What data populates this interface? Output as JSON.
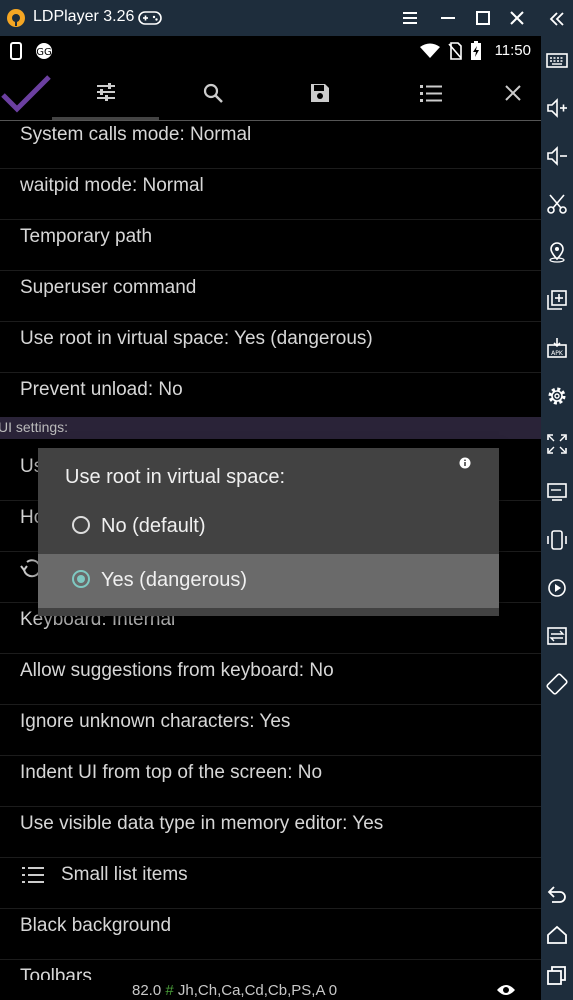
{
  "app": {
    "title": "LDPlayer 3.26"
  },
  "statusbar": {
    "time": "11:50"
  },
  "settings_rows": [
    "System calls mode: Normal",
    "waitpid mode: Normal",
    "Temporary path",
    "Superuser command",
    "Use root in virtual space: Yes (dangerous)",
    "Prevent unload: No"
  ],
  "section": {
    "label": "UI settings:"
  },
  "partial_rows": [
    "Us",
    "Ho"
  ],
  "settings_rows_lower": [
    "Keyboard: Internal",
    "Allow suggestions from keyboard: No",
    "Ignore unknown characters: Yes",
    "Indent UI from top of the screen: No",
    "Use visible data type in memory editor: Yes",
    "Small list items",
    "Black background",
    "Toolbars"
  ],
  "dialog": {
    "title": "Use root in virtual space:",
    "options": [
      {
        "label": "No (default)",
        "selected": false
      },
      {
        "label": "Yes (dangerous)",
        "selected": true
      }
    ]
  },
  "bottom": {
    "value": "82.0",
    "hash": "#",
    "regions": "Jh,Ch,Ca,Cd,Cb,PS,A",
    "count": "0"
  },
  "colors": {
    "titlebar": "#1e2d3c",
    "accent": "#7fc9c2",
    "check": "#6b3fa0",
    "section_bg": "#2a2338"
  }
}
